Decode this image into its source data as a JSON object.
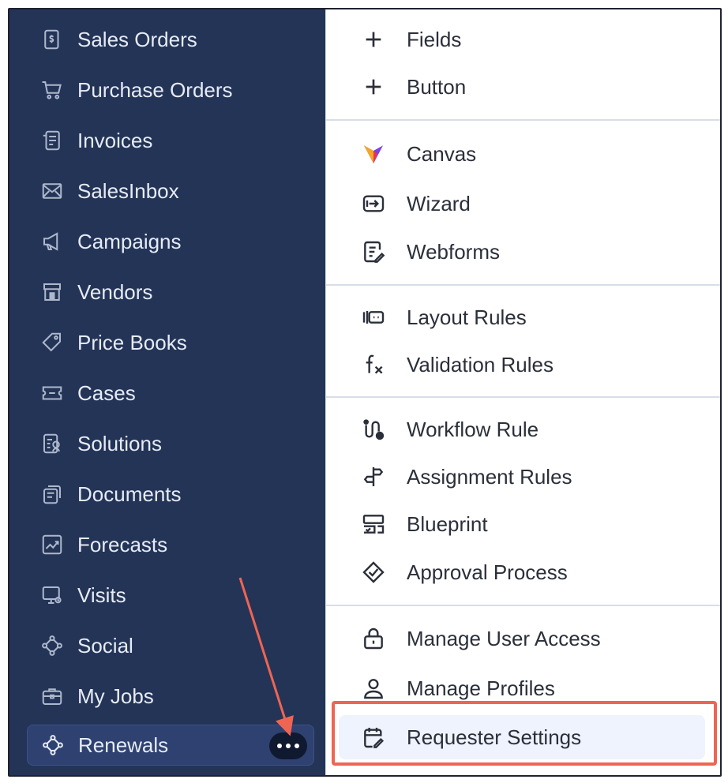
{
  "sidebar": {
    "items": [
      {
        "label": "Sales Orders",
        "icon": "sales-orders-icon"
      },
      {
        "label": "Purchase Orders",
        "icon": "cart-icon"
      },
      {
        "label": "Invoices",
        "icon": "invoice-icon"
      },
      {
        "label": "SalesInbox",
        "icon": "mail-icon"
      },
      {
        "label": "Campaigns",
        "icon": "megaphone-icon"
      },
      {
        "label": "Vendors",
        "icon": "store-icon"
      },
      {
        "label": "Price Books",
        "icon": "tag-icon"
      },
      {
        "label": "Cases",
        "icon": "ticket-icon"
      },
      {
        "label": "Solutions",
        "icon": "solution-icon"
      },
      {
        "label": "Documents",
        "icon": "documents-icon"
      },
      {
        "label": "Forecasts",
        "icon": "chart-icon"
      },
      {
        "label": "Visits",
        "icon": "monitor-icon"
      },
      {
        "label": "Social",
        "icon": "social-icon"
      },
      {
        "label": "My Jobs",
        "icon": "briefcase-icon"
      },
      {
        "label": "Renewals",
        "icon": "renewals-icon"
      }
    ],
    "more_button_icon": "ellipsis-icon"
  },
  "menu": {
    "items": [
      {
        "label": "Fields",
        "icon": "plus-icon"
      },
      {
        "label": "Button",
        "icon": "plus-icon"
      },
      {
        "label": "Canvas",
        "icon": "canvas-icon"
      },
      {
        "label": "Wizard",
        "icon": "wizard-icon"
      },
      {
        "label": "Webforms",
        "icon": "webforms-icon"
      },
      {
        "label": "Layout Rules",
        "icon": "layout-rules-icon"
      },
      {
        "label": "Validation Rules",
        "icon": "function-icon"
      },
      {
        "label": "Workflow Rule",
        "icon": "workflow-icon"
      },
      {
        "label": "Assignment Rules",
        "icon": "signpost-icon"
      },
      {
        "label": "Blueprint",
        "icon": "blueprint-icon"
      },
      {
        "label": "Approval Process",
        "icon": "approval-icon"
      },
      {
        "label": "Manage User Access",
        "icon": "lock-icon"
      },
      {
        "label": "Manage Profiles",
        "icon": "user-icon"
      },
      {
        "label": "Requester Settings",
        "icon": "requester-settings-icon"
      }
    ]
  },
  "colors": {
    "sidebar_bg": "#243457",
    "sidebar_text": "#e6ebf5",
    "menu_bg": "#ffffff",
    "highlight_bg": "#eef3fd",
    "annotation_red": "#ef6553"
  }
}
